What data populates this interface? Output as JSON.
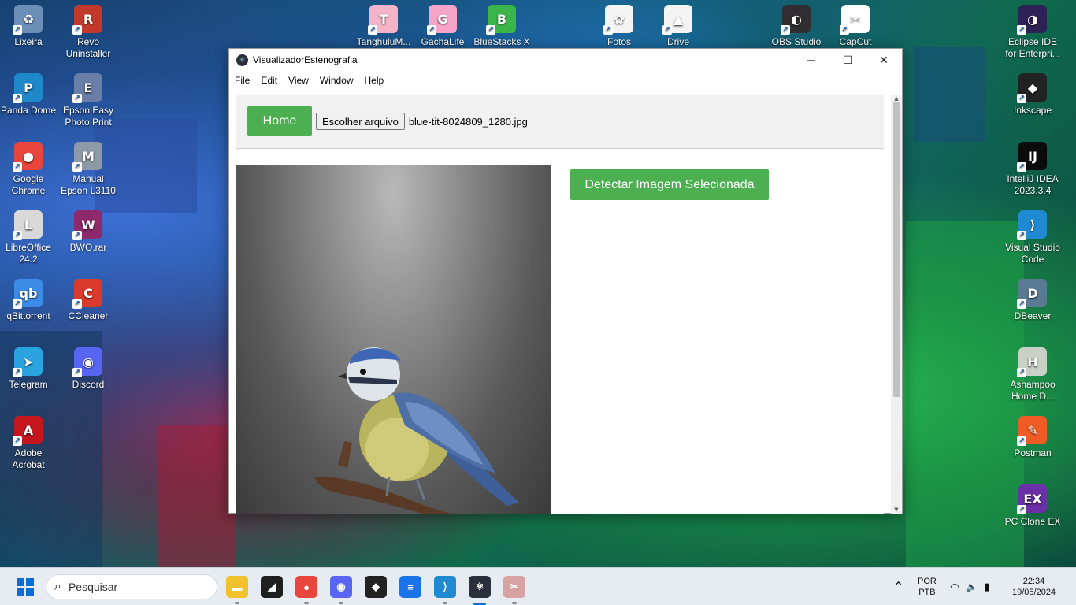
{
  "desktop": {
    "icons_left": [
      {
        "label": "Lixeira",
        "glyph": "♻",
        "color": "#6b8fb8",
        "icon": "recycle-bin-icon"
      },
      {
        "label": "Revo Uninstaller",
        "glyph": "R",
        "color": "#c0392b",
        "icon": "revo-uninstaller-icon"
      },
      {
        "label": "Panda Dome",
        "glyph": "P",
        "color": "#1e88c9",
        "icon": "panda-dome-icon"
      },
      {
        "label": "Epson Easy Photo Print",
        "glyph": "E",
        "color": "#6a7fa8",
        "icon": "epson-photo-icon"
      },
      {
        "label": "Google Chrome",
        "glyph": "●",
        "color": "#e8453c",
        "icon": "chrome-icon"
      },
      {
        "label": "Manual Epson L3110",
        "glyph": "M",
        "color": "#8e9aa8",
        "icon": "manual-icon"
      },
      {
        "label": "LibreOffice 24.2",
        "glyph": "L",
        "color": "#d9d9d9",
        "icon": "libreoffice-icon"
      },
      {
        "label": "BWO.rar",
        "glyph": "W",
        "color": "#8e2a6b",
        "icon": "winrar-icon"
      },
      {
        "label": "qBittorrent",
        "glyph": "qb",
        "color": "#3c8ce7",
        "icon": "qbittorrent-icon"
      },
      {
        "label": "CCleaner",
        "glyph": "C",
        "color": "#d93a2b",
        "icon": "ccleaner-icon"
      },
      {
        "label": "Telegram",
        "glyph": "➤",
        "color": "#2aa3df",
        "icon": "telegram-icon"
      },
      {
        "label": "Discord",
        "glyph": "◉",
        "color": "#5865f2",
        "icon": "discord-icon"
      },
      {
        "label": "Adobe Acrobat",
        "glyph": "A",
        "color": "#c4161c",
        "icon": "acrobat-icon"
      }
    ],
    "icons_top": [
      {
        "label": "TanghuluM...",
        "glyph": "T",
        "color": "#f3b3c9",
        "icon": "tanghulu-icon"
      },
      {
        "label": "GachaLife",
        "glyph": "G",
        "color": "#f6a5c8",
        "icon": "gachalife-icon"
      },
      {
        "label": "BlueStacks X",
        "glyph": "B",
        "color": "#3bb54a",
        "icon": "bluestacks-icon"
      },
      {
        "label": "Fotos",
        "glyph": "✿",
        "color": "#f4f4f4",
        "icon": "google-photos-icon"
      },
      {
        "label": "Drive",
        "glyph": "▲",
        "color": "#f4f4f4",
        "icon": "google-drive-icon"
      },
      {
        "label": "OBS Studio",
        "glyph": "◐",
        "color": "#302e31",
        "icon": "obs-icon"
      },
      {
        "label": "CapCut",
        "glyph": "✂",
        "color": "#ffffff",
        "icon": "capcut-icon"
      }
    ],
    "icons_right": [
      {
        "label": "Eclipse IDE for Enterpri...",
        "glyph": "◑",
        "color": "#2c2255",
        "icon": "eclipse-icon"
      },
      {
        "label": "Inkscape",
        "glyph": "◆",
        "color": "#222222",
        "icon": "inkscape-icon"
      },
      {
        "label": "IntelliJ IDEA 2023.3.4",
        "glyph": "IJ",
        "color": "#0b0b0b",
        "icon": "intellij-icon"
      },
      {
        "label": "Visual Studio Code",
        "glyph": "⟩",
        "color": "#1f8ad2",
        "icon": "vscode-icon"
      },
      {
        "label": "DBeaver",
        "glyph": "D",
        "color": "#5a7a94",
        "icon": "dbeaver-icon"
      },
      {
        "label": "Ashampoo Home D...",
        "glyph": "H",
        "color": "#c9d1c6",
        "icon": "ashampoo-icon"
      },
      {
        "label": "Postman",
        "glyph": "✎",
        "color": "#ef5b25",
        "icon": "postman-icon"
      },
      {
        "label": "PC Clone EX",
        "glyph": "EX",
        "color": "#6b2fa8",
        "icon": "pcclone-icon"
      }
    ]
  },
  "window": {
    "title": "VisualizadorEstenografia",
    "app_glyph": "⚛",
    "controls": {
      "minimize": "─",
      "maximize": "☐",
      "close": "✕"
    },
    "menu": [
      "File",
      "Edit",
      "View",
      "Window",
      "Help"
    ],
    "home_label": "Home",
    "file_button_label": "Escolher arquivo",
    "file_name": "blue-tit-8024809_1280.jpg",
    "detect_label": "Detectar Imagem Selecionada",
    "accent": "#4caf50"
  },
  "taskbar": {
    "search_placeholder": "Pesquisar",
    "search_glyph": "⌕",
    "apps": [
      {
        "glyph": "▬",
        "color": "#f2c12e",
        "icon": "file-explorer-icon"
      },
      {
        "glyph": "◢",
        "color": "#1f1f1f",
        "icon": "sticky-notes-icon"
      },
      {
        "glyph": "●",
        "color": "#e8453c",
        "icon": "chrome-taskbar-icon"
      },
      {
        "glyph": "◉",
        "color": "#5865f2",
        "icon": "discord-taskbar-icon"
      },
      {
        "glyph": "◆",
        "color": "#222222",
        "icon": "inkscape-taskbar-icon"
      },
      {
        "glyph": "≡",
        "color": "#1a73e8",
        "icon": "docs-taskbar-icon"
      },
      {
        "glyph": "⟩",
        "color": "#1f8ad2",
        "icon": "vscode-taskbar-icon"
      },
      {
        "glyph": "⚛",
        "color": "#2b2e3b",
        "icon": "electron-taskbar-icon"
      },
      {
        "glyph": "✂",
        "color": "#d6a2a2",
        "icon": "snipping-tool-icon"
      }
    ],
    "tray_arrow": "⌃",
    "lang_top": "POR",
    "lang_bottom": "PTB",
    "wifi_glyph": "◠",
    "volume_glyph": "🔈",
    "battery_glyph": "▮",
    "time": "22:34",
    "date": "19/05/2024"
  }
}
